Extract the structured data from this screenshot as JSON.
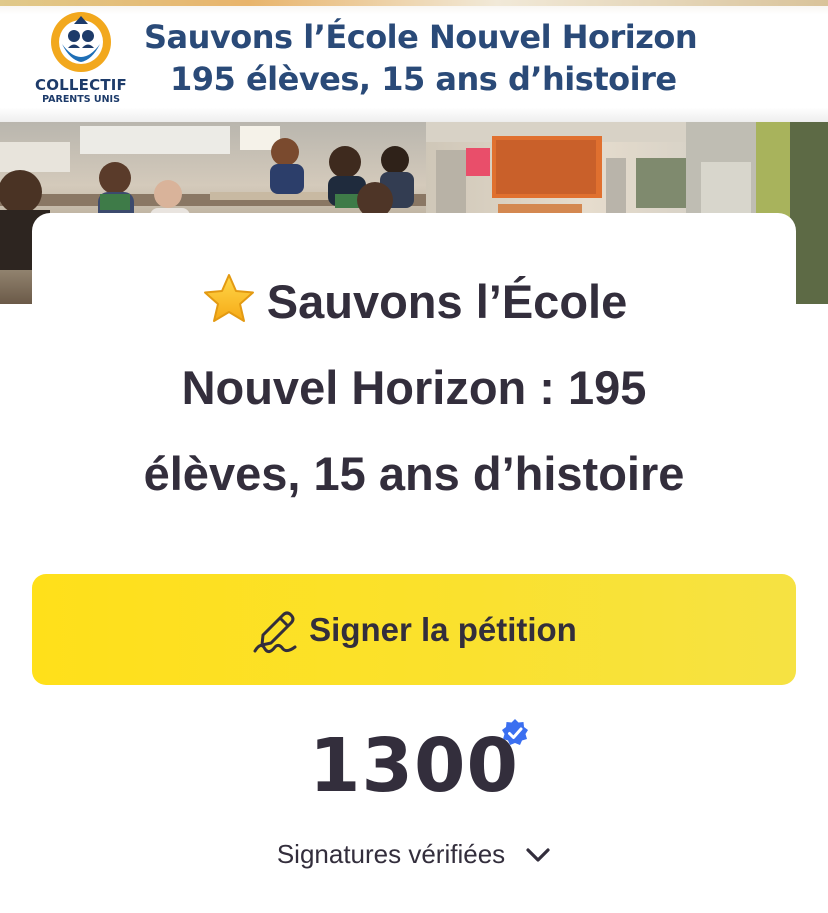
{
  "banner": {
    "logo_line1": "COLLECTIF",
    "logo_line2": "PARENTS UNIS",
    "headline1": "Sauvons l’École Nouvel Horizon",
    "headline2": "195 élèves, 15 ans d’histoire"
  },
  "petition": {
    "title_icon": "star-icon",
    "title_line1": "Sauvons l’École",
    "title_line2": "Nouvel Horizon : 195",
    "title_line3": "élèves, 15 ans d’histoire",
    "sign_label": "Signer la pétition",
    "sign_icon": "pen-signature-icon",
    "signature_count": "1300",
    "verified_icon": "verified-badge-icon",
    "signatures_label": "Signatures vérifiées",
    "expand_icon": "chevron-down-icon"
  },
  "colors": {
    "text": "#332e3c",
    "button": "#fbe12b",
    "banner_text": "#2a4a78",
    "verified": "#3b6ff0"
  }
}
